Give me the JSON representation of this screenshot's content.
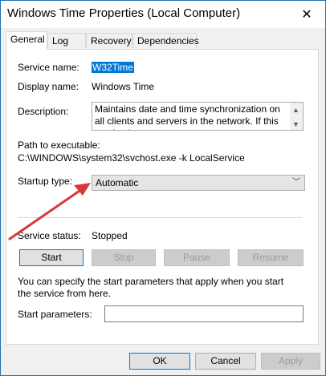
{
  "window": {
    "title": "Windows Time Properties (Local Computer)",
    "close_glyph": "✕"
  },
  "tabs": [
    "General",
    "Log On",
    "Recovery",
    "Dependencies"
  ],
  "general": {
    "service_name_label": "Service name:",
    "service_name_value": "W32Time",
    "display_name_label": "Display name:",
    "display_name_value": "Windows Time",
    "description_label": "Description:",
    "description_value": "Maintains date and time synchronization on all clients and servers in the network. If this service is",
    "path_label": "Path to executable:",
    "path_value": "C:\\WINDOWS\\system32\\svchost.exe -k LocalService",
    "startup_type_label": "Startup type:",
    "startup_type_value": "Automatic",
    "service_status_label": "Service status:",
    "service_status_value": "Stopped",
    "buttons": {
      "start": "Start",
      "stop": "Stop",
      "pause": "Pause",
      "resume": "Resume"
    },
    "help_text": "You can specify the start parameters that apply when you start the service from here.",
    "start_params_label": "Start parameters:",
    "start_params_value": ""
  },
  "footer": {
    "ok": "OK",
    "cancel": "Cancel",
    "apply": "Apply"
  },
  "colors": {
    "annotation_arrow": "#d9383a",
    "selection": "#0078d7"
  }
}
